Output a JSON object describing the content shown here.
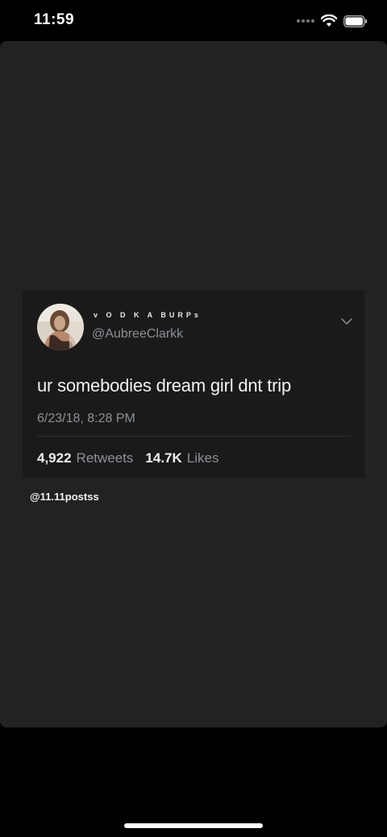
{
  "status_bar": {
    "time": "11:59",
    "icons": [
      "signal-icon",
      "wifi-icon",
      "battery-icon"
    ]
  },
  "tweet": {
    "display_name": "v O D K A BURPs",
    "handle": "@AubreeClarkk",
    "text": "ur somebodies dream girl dnt trip",
    "date": "6/23/18, 8:28 PM",
    "retweets_count": "4,922",
    "retweets_label": "Retweets",
    "likes_count": "14.7K",
    "likes_label": "Likes"
  },
  "watermark": "@11.11postss",
  "colors": {
    "background": "#000000",
    "sheet": "#222222",
    "card": "#1a1a1a",
    "secondary_text": "#8c9197"
  }
}
